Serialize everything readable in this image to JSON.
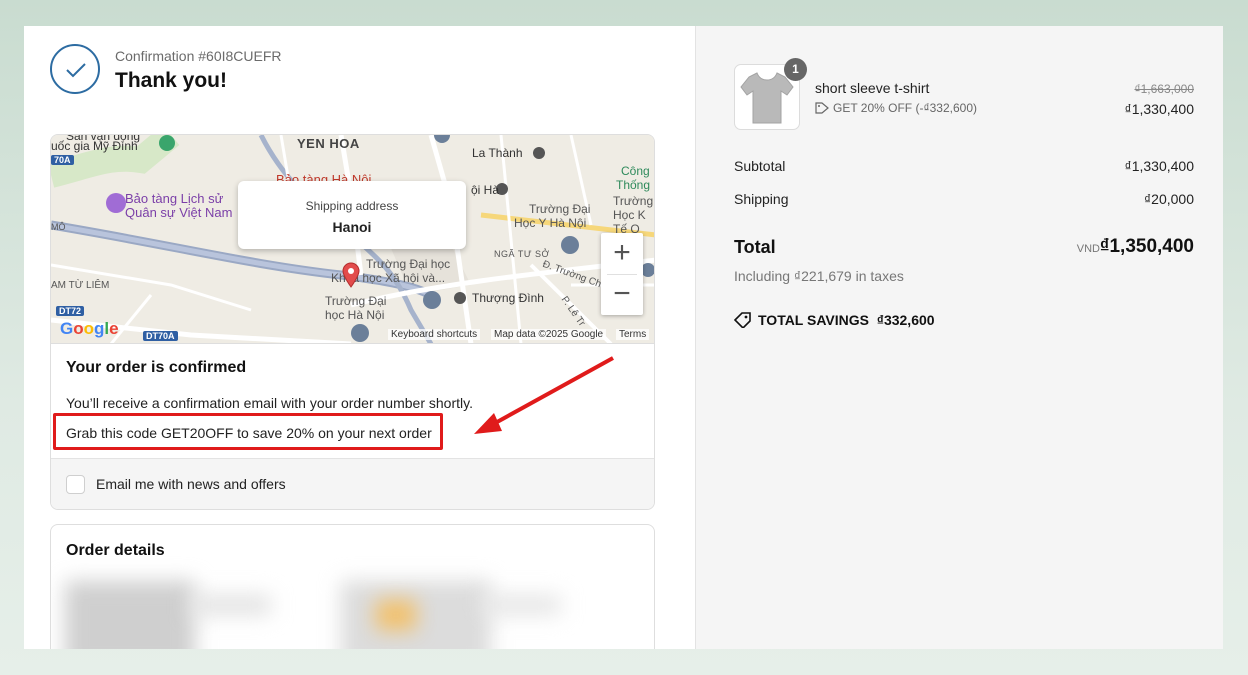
{
  "header": {
    "confirmation_number": "Confirmation #60I8CUEFR",
    "title": "Thank you!"
  },
  "map": {
    "popup_label": "Shipping address",
    "popup_city": "Hanoi",
    "labels": {
      "yen_hoa": "YEN HOA",
      "la_thanh": "La Thành",
      "cong_thong": "Công",
      "cong_thong2": "Thống",
      "bao_tang_ls": "Bảo tàng Lịch sử",
      "quan_su": "Quân sự Việt Nam",
      "bao_tang_hn": "Bảo tàng Hà Nội",
      "mo": "MÔ",
      "san_van_dong": "Sân vận động",
      "quoc_gia": "uốc gia Mỹ Đình",
      "ha": "ội Hà",
      "truong_dh_y": "Trường Đại",
      "hoc_y": "Học Y Hà Nội",
      "truong_k": "Trường",
      "hoc_k": "Học K",
      "te_q": "Tế Q",
      "nga_tu_so": "NGÃ TƯ SỞ",
      "truong_chinh": "Đ. Trường Ch",
      "truong_dh_xh": "Trường Đại học",
      "xa_hoi": "Khoa học Xã hội và...",
      "nam_tu_liem": "AM TỪ LIÊM",
      "truong_dh_hn": "Trường Đại",
      "hoc_hn": "học Hà Nội",
      "thuong_dinh": "Thượng Đình",
      "le_trong": "P. Lê Tr",
      "dt72": "DT72",
      "dt70a": "DT70A",
      "r70a": "70A"
    },
    "google": "Google",
    "keyboard_shortcuts": "Keyboard shortcuts",
    "map_data": "Map data ©2025 Google",
    "terms": "Terms",
    "zoom_in": "+",
    "zoom_out": "−"
  },
  "confirmation": {
    "title": "Your order is confirmed",
    "line1": "You’ll receive a confirmation email with your order number shortly.",
    "line2": "Grab this code GET20OFF to save 20% on your next order",
    "newsletter_label": "Email me with news and offers",
    "newsletter_checked": false
  },
  "order_details": {
    "title": "Order details"
  },
  "summary": {
    "item": {
      "name": "short sleeve t-shirt",
      "quantity": "1",
      "discount": "GET 20% OFF (-₫332,600)",
      "original_price": "₫1,663,000",
      "price": "₫1,330,400"
    },
    "subtotal_label": "Subtotal",
    "subtotal_value": "₫1,330,400",
    "shipping_label": "Shipping",
    "shipping_value": "₫20,000",
    "total_label": "Total",
    "total_currency": "VND",
    "total_value": "₫1,350,400",
    "taxes": "Including ₫221,679 in taxes",
    "savings_label": "TOTAL SAVINGS",
    "savings_value": "₫332,600"
  },
  "colors": {
    "accent": "#2d6ca2",
    "highlight": "#e01b1b",
    "page_bg": "#c9dcd0"
  }
}
